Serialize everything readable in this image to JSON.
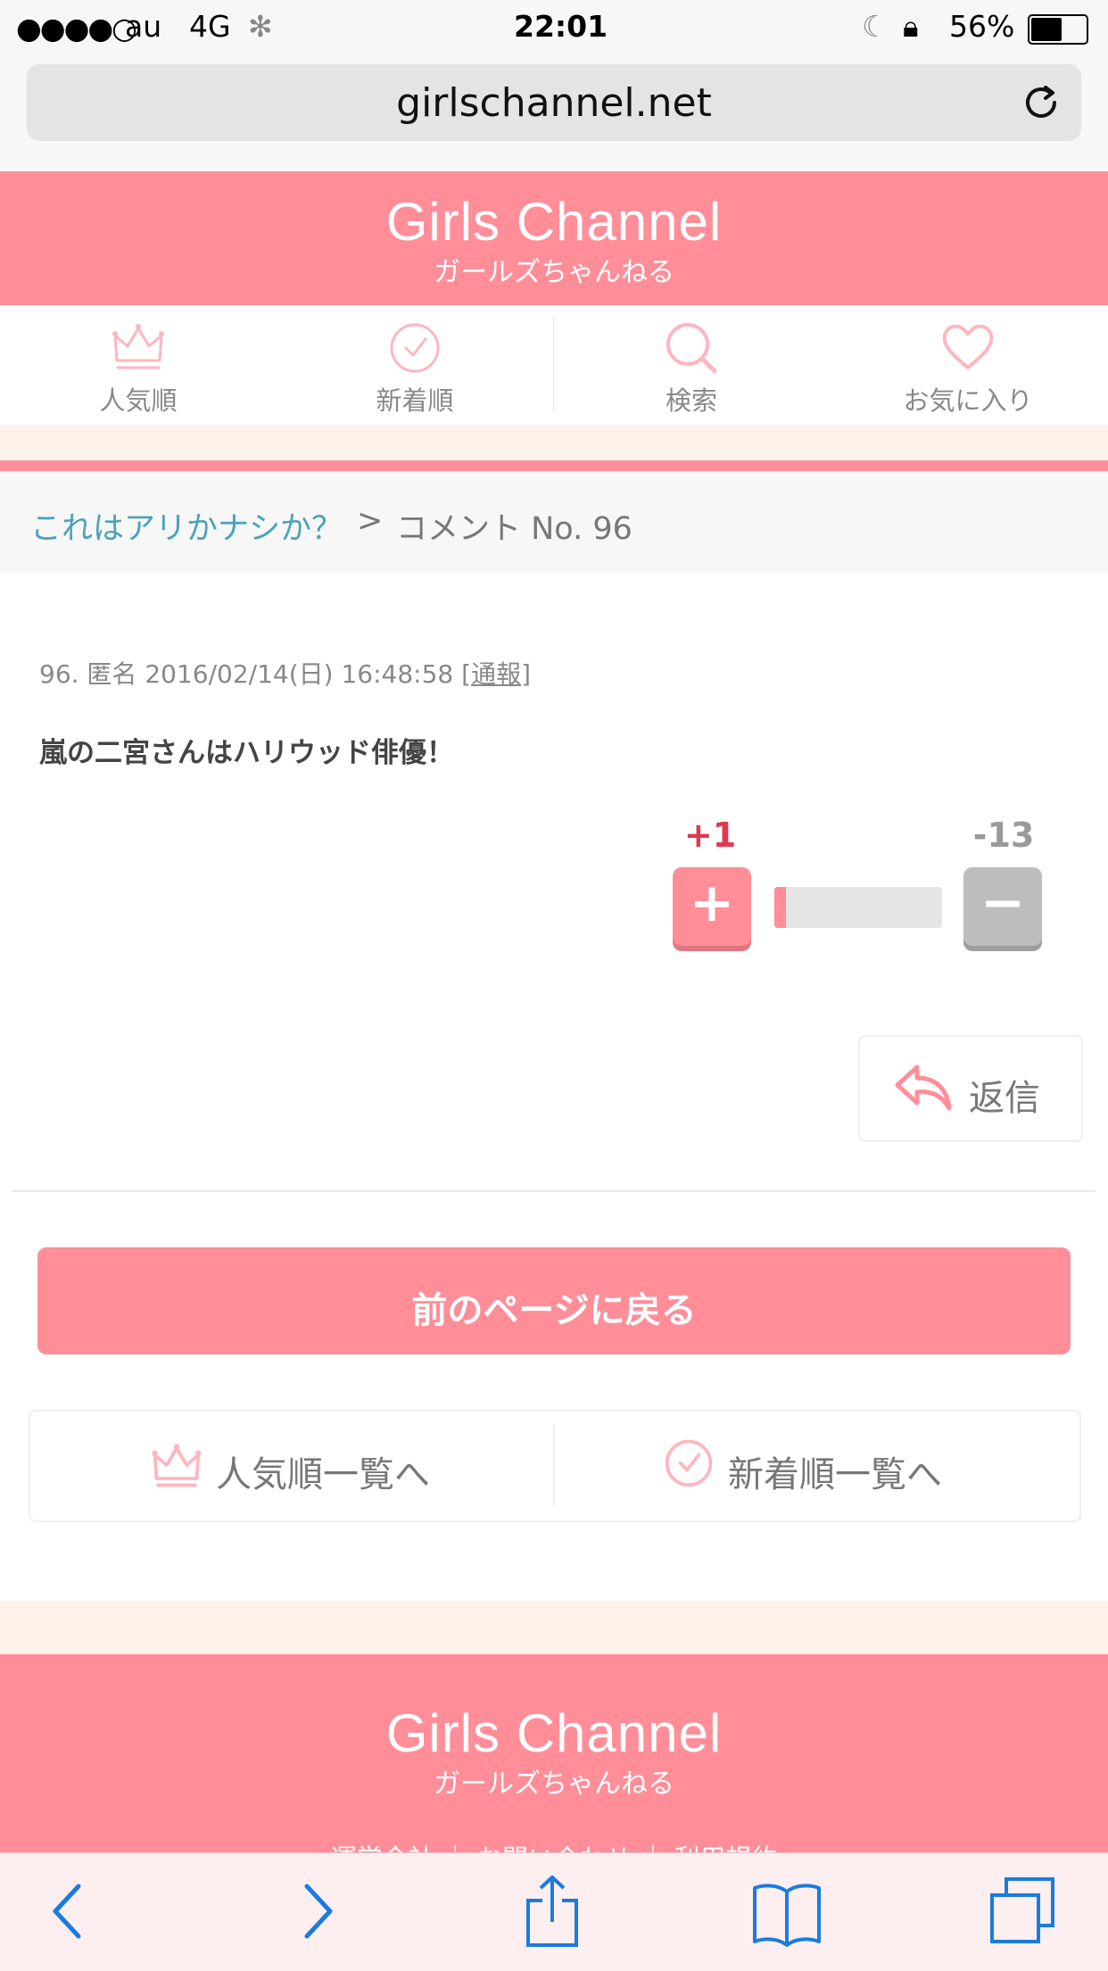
{
  "status_bar": {
    "carrier": "au",
    "network": "4G",
    "time": "22:01",
    "battery": "56%",
    "battery_level": 0.56
  },
  "browser": {
    "url": "girlschannel.net"
  },
  "header": {
    "logo": "Girls Channel",
    "logo_sub": "ガールズちゃんねる"
  },
  "nav": {
    "items": [
      {
        "label": "人気順",
        "icon": "crown-icon"
      },
      {
        "label": "新着順",
        "icon": "clock-icon"
      },
      {
        "label": "検索",
        "icon": "search-icon"
      },
      {
        "label": "お気に入り",
        "icon": "heart-icon"
      }
    ]
  },
  "breadcrumb": {
    "link": "これはアリかナシか？",
    "separator": ">",
    "current": "コメント No. 96"
  },
  "comment": {
    "meta": "96. 匿名 2016/02/14(日) 16:48:58",
    "report_open": "[",
    "report_label": "通報",
    "report_close": "]",
    "body": "嵐の二宮さんはハリウッド俳優！"
  },
  "vote": {
    "plus_count": "+1",
    "minus_count": "-13",
    "plus_symbol": "+",
    "minus_symbol": "−",
    "plus_ratio": 0.07
  },
  "reply": {
    "label": "返信"
  },
  "back_button": {
    "label": "前のページに戻る"
  },
  "bottom_links": {
    "popular": "人気順一覧へ",
    "new": "新着順一覧へ"
  },
  "footer": {
    "logo": "Girls Channel",
    "logo_sub": "ガールズちゃんねる",
    "links": "運営会社 ｜ お問い合わせ ｜ 利用規約"
  },
  "colors": {
    "brand_pink": "#ff8e99",
    "link_teal": "#4ba3b8",
    "plus_red": "#e0394f",
    "ios_blue": "#1a7be0"
  }
}
